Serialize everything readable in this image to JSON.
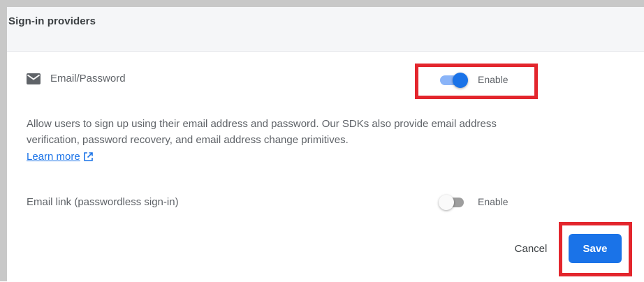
{
  "panel": {
    "title": "Sign-in providers"
  },
  "providers": {
    "email_password": {
      "icon": "mail-icon",
      "label": "Email/Password",
      "toggle_label": "Enable",
      "enabled": true,
      "description": "Allow users to sign up using their email address and password. Our SDKs also provide email address verification, password recovery, and email address change primitives.",
      "learn_more_label": "Learn more",
      "learn_more_icon": "external-link-icon"
    },
    "email_link": {
      "label": "Email link (passwordless sign-in)",
      "toggle_label": "Enable",
      "enabled": false
    }
  },
  "actions": {
    "cancel_label": "Cancel",
    "save_label": "Save"
  },
  "colors": {
    "primary": "#1a73e8",
    "toggle_on_track": "#8ab4f8",
    "toggle_off_track": "#9e9e9e",
    "highlight": "#e3262d",
    "text_secondary": "#5f6368"
  }
}
